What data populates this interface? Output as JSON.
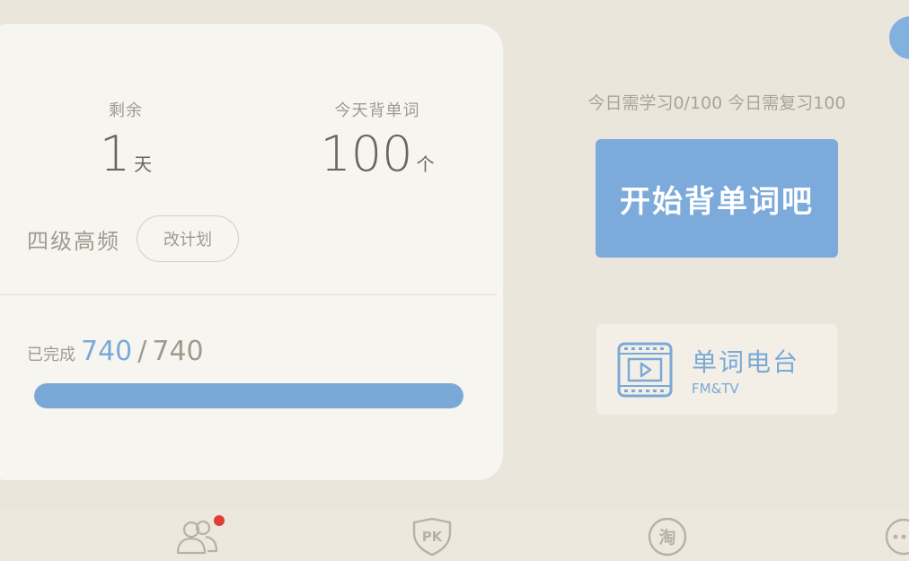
{
  "plan": {
    "remaining_label": "剩余",
    "remaining_value": "1",
    "remaining_unit": "天",
    "today_label": "今天背单词",
    "today_value": "100",
    "today_unit": "个",
    "book_name": "四级高频",
    "change_plan_label": "改计划",
    "progress_label": "已完成",
    "progress_done": "740",
    "progress_sep": "/",
    "progress_total": "740",
    "progress_fraction": 1.0
  },
  "today": {
    "info": "今日需学习0/100 今日需复习100"
  },
  "start_button": {
    "label": "开始背单词吧"
  },
  "radio": {
    "title": "单词电台",
    "subtitle": "FM&TV"
  },
  "bottom_nav": {
    "items": [
      {
        "name": "friends",
        "icon": "friends-icon",
        "has_notification": true
      },
      {
        "name": "pk",
        "icon": "pk-shield-icon",
        "glyph": "PK"
      },
      {
        "name": "shop",
        "icon": "shop-icon",
        "glyph": "淘"
      },
      {
        "name": "more",
        "icon": "more-icon"
      }
    ]
  },
  "colors": {
    "accent": "#7caadb",
    "background": "#ebe6dc",
    "card": "#f7f5f0",
    "notification": "#e53b37"
  }
}
